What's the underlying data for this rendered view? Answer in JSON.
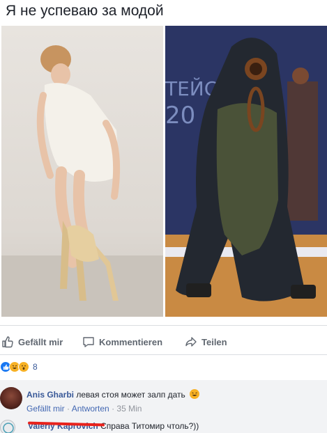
{
  "post": {
    "title": "Я не успеваю за модой"
  },
  "actions": {
    "like_label": "Gefällt mir",
    "comment_label": "Kommentieren",
    "share_label": "Teilen"
  },
  "reactions": {
    "count": "8",
    "types": [
      "like-icon",
      "haha-icon",
      "wow-icon"
    ]
  },
  "comments": [
    {
      "author": "Anis Gharbi",
      "text": "левая стоя может залп дать",
      "like_label": "Gefällt mir",
      "reply_label": "Antworten",
      "separator": "·",
      "time": "35 Min"
    },
    {
      "author": "Valeriy Kaprovich",
      "text": "Справа Титомир чтоль?))"
    }
  ],
  "colors": {
    "link": "#385898",
    "muted": "#606770",
    "meta": "#90949c",
    "accent": "#1877f2",
    "redaction": "#e8221c"
  }
}
